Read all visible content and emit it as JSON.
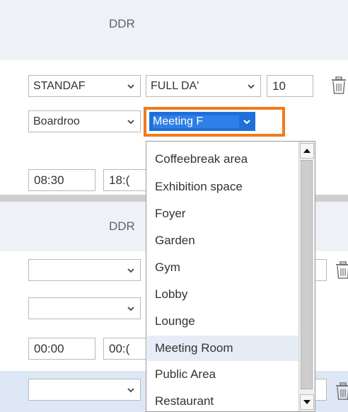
{
  "section1": {
    "header": "DDR",
    "row1": {
      "type_value": "STANDAF",
      "duration_value": "FULL DA'",
      "quantity_value": "10"
    },
    "row2": {
      "room_value": "Boardroo",
      "space_value": "Meeting F"
    },
    "row3": {
      "start_time": "08:30",
      "end_time": "18:("
    }
  },
  "section2": {
    "header": "DDR",
    "row1": {
      "type_value": "",
      "quantity_value": ""
    },
    "row2": {
      "room_value": ""
    },
    "row3": {
      "start_time": "00:00",
      "end_time": "00:("
    },
    "row4": {
      "type_value": ""
    }
  },
  "dropdown": {
    "items": [
      {
        "label": "Coffeebreak area"
      },
      {
        "label": "Exhibition space"
      },
      {
        "label": "Foyer"
      },
      {
        "label": "Garden"
      },
      {
        "label": "Gym"
      },
      {
        "label": "Lobby"
      },
      {
        "label": "Lounge"
      },
      {
        "label": "Meeting Room",
        "selected": true
      },
      {
        "label": "Public Area"
      },
      {
        "label": "Restaurant"
      }
    ]
  },
  "colors": {
    "accent_highlight": "#f07b1c",
    "selection_blue": "#1e6fd9",
    "header_band": "#eef1f5",
    "selected_row": "#dde7f5"
  },
  "icons": {
    "chevron": "chevron-down-icon",
    "trash": "trash-icon",
    "scroll_up": "scroll-up-arrow-icon",
    "scroll_down": "scroll-down-arrow-icon"
  }
}
